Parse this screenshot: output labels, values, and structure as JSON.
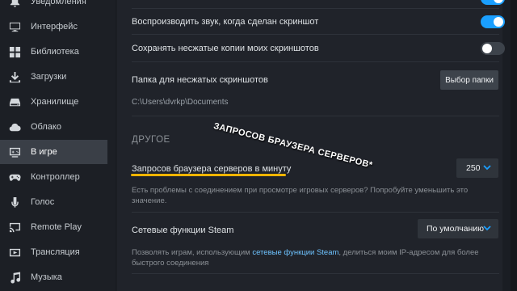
{
  "sidebar": {
    "items": [
      {
        "label": "Уведомления",
        "icon": "bell-icon",
        "active": false
      },
      {
        "label": "Интерфейс",
        "icon": "monitor-icon",
        "active": false
      },
      {
        "label": "Библиотека",
        "icon": "grid-icon",
        "active": false
      },
      {
        "label": "Загрузки",
        "icon": "download-icon",
        "active": false
      },
      {
        "label": "Хранилище",
        "icon": "drive-icon",
        "active": false
      },
      {
        "label": "Облако",
        "icon": "cloud-icon",
        "active": false
      },
      {
        "label": "В игре",
        "icon": "gamepad-screen-icon",
        "active": true
      },
      {
        "label": "Контроллер",
        "icon": "controller-icon",
        "active": false
      },
      {
        "label": "Голос",
        "icon": "microphone-icon",
        "active": false
      },
      {
        "label": "Remote Play",
        "icon": "remote-play-icon",
        "active": false
      },
      {
        "label": "Трансляция",
        "icon": "broadcast-icon",
        "active": false
      },
      {
        "label": "Музыка",
        "icon": "music-icon",
        "active": false
      }
    ]
  },
  "settings": {
    "play_sound": {
      "label": "Воспроизводить звук, когда сделан скриншот",
      "enabled": true
    },
    "save_uncompressed": {
      "label": "Сохранять несжатые копии моих скриншотов",
      "enabled": false
    },
    "folder": {
      "label": "Папка для несжатых скриншотов",
      "button": "Выбор папки",
      "path": "C:\\Users\\dvrkp\\Documents"
    },
    "other_section": "ДРУГОЕ",
    "server_browser": {
      "label": "Запросов браузера серверов в минуту",
      "value": "250",
      "description": "Есть проблемы с соединением при просмотре игровых серверов? Попробуйте уменьшить это значение."
    },
    "steam_networking": {
      "label": "Сетевые функции Steam",
      "value": "По умолчанию",
      "desc_before": "Позволять играм, использующим ",
      "desc_link": "сетевые функции Steam",
      "desc_after": ", делиться моим IP-адресом для более быстрого соединения"
    }
  },
  "overlay": {
    "caption": "ЗАПРОСОВ БРАУЗЕРА СЕРВЕРОВ*",
    "accent": "#f0b400"
  },
  "colors": {
    "toggle_on": "#1a9fff",
    "link": "#6ec3ff"
  }
}
